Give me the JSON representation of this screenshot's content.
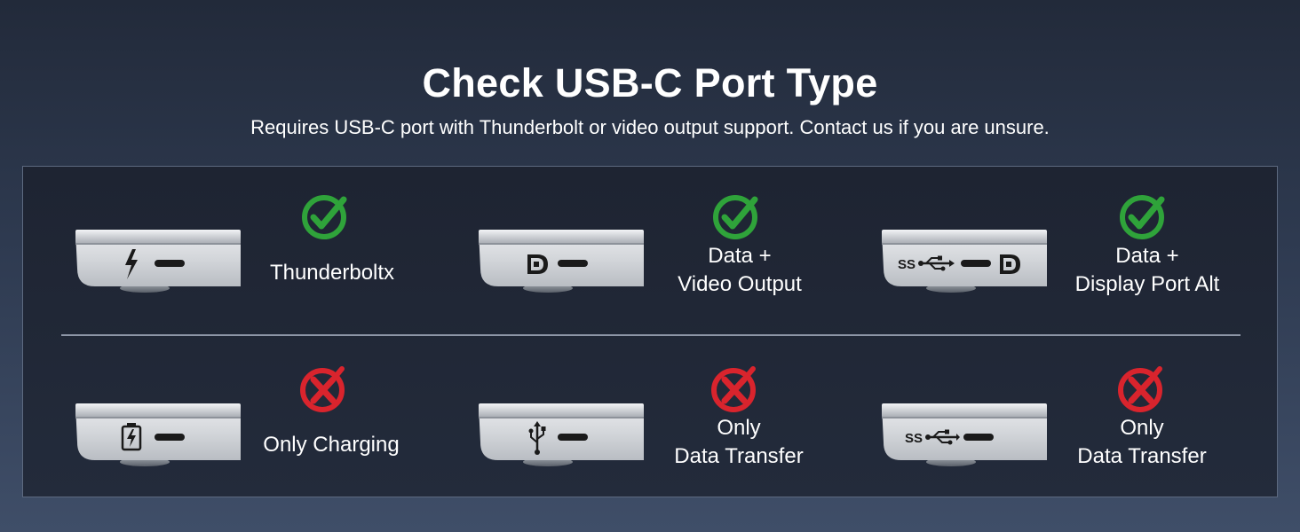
{
  "header": {
    "title": "Check USB-C Port Type",
    "subtitle": "Requires USB-C port with Thunderbolt or video output support. Contact us if you are unsure."
  },
  "colors": {
    "supported": "#2fa33a",
    "unsupported": "#d9242d"
  },
  "supported_ports": [
    {
      "icon": "thunderbolt-icon",
      "status": "check-icon",
      "lines": [
        "Thunderboltx"
      ]
    },
    {
      "icon": "displayport-icon",
      "status": "check-icon",
      "lines": [
        "Data +",
        "Video Output"
      ]
    },
    {
      "icon": "superspeed-usb-displayport-icon",
      "status": "check-icon",
      "lines": [
        "Data +",
        "Display Port Alt"
      ]
    }
  ],
  "unsupported_ports": [
    {
      "icon": "battery-charging-icon",
      "status": "x-icon",
      "lines": [
        "Only Charging"
      ]
    },
    {
      "icon": "usb-trident-icon",
      "status": "x-icon",
      "lines": [
        "Only",
        "Data Transfer"
      ]
    },
    {
      "icon": "superspeed-usb-icon",
      "status": "x-icon",
      "lines": [
        "Only",
        "Data Transfer"
      ]
    }
  ]
}
